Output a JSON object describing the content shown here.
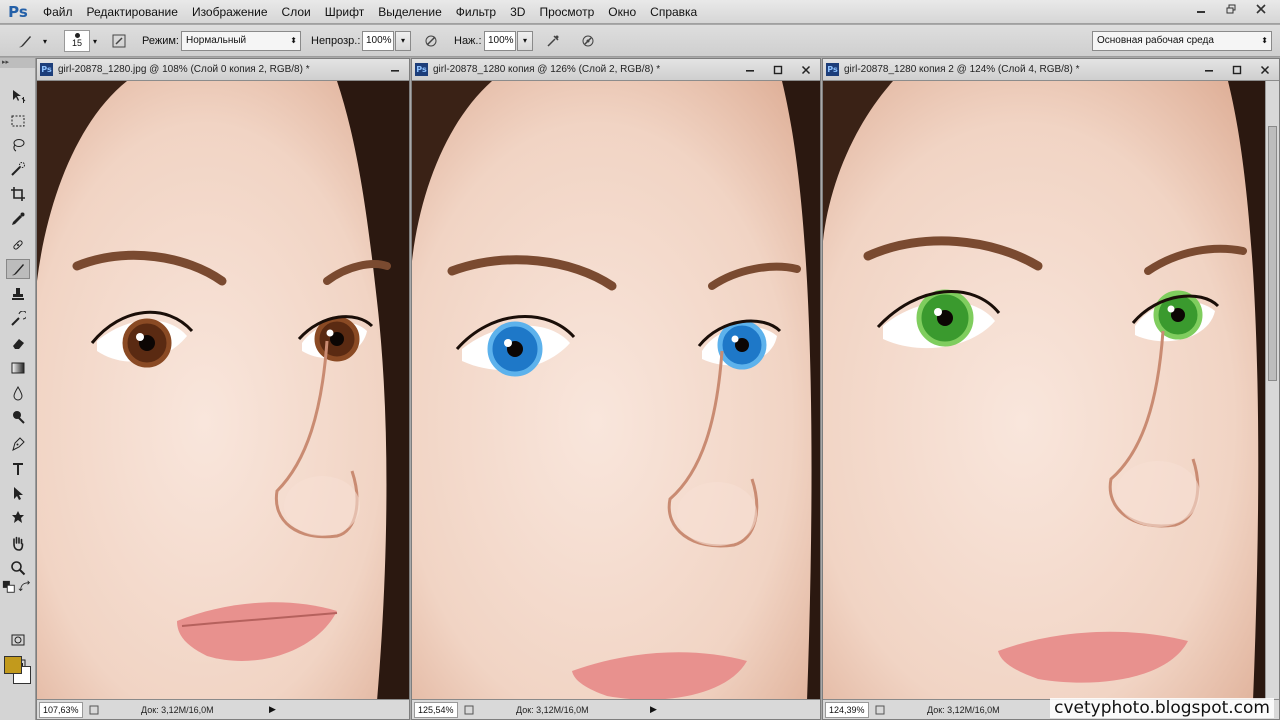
{
  "app": {
    "logo": "Ps"
  },
  "menu": [
    "Файл",
    "Редактирование",
    "Изображение",
    "Слои",
    "Шрифт",
    "Выделение",
    "Фильтр",
    "3D",
    "Просмотр",
    "Окно",
    "Справка"
  ],
  "options": {
    "brush_size": "15",
    "mode_label": "Режим:",
    "mode_value": "Нормальный",
    "opacity_label": "Непрозр.:",
    "opacity_value": "100%",
    "pressure_label": "Наж.:",
    "pressure_value": "100%",
    "workspace": "Основная рабочая среда"
  },
  "tools_panel": {
    "grip": "▸▸"
  },
  "documents": [
    {
      "title": "girl-20878_1280.jpg @ 108% (Слой 0 копия 2, RGB/8) *",
      "zoom": "107,63%",
      "info": "Док: 3,12M/16,0M",
      "eye_color": "#5a2a12",
      "iris_light": "#8a4a24"
    },
    {
      "title": "girl-20878_1280 копия @ 126% (Слой 2, RGB/8) *",
      "zoom": "125,54%",
      "info": "Док: 3,12M/16,0M",
      "eye_color": "#1e78c8",
      "iris_light": "#5db2ec"
    },
    {
      "title": "girl-20878_1280 копия 2 @ 124% (Слой 4, RGB/8) *",
      "zoom": "124,39%",
      "info": "Док: 3,12M/16,0M",
      "eye_color": "#3a9a2e",
      "iris_light": "#7fcd5e"
    }
  ],
  "colors": {
    "foreground": "#c29a1c",
    "background": "#ffffff"
  },
  "watermark": "cvetyphoto.blogspot.com"
}
